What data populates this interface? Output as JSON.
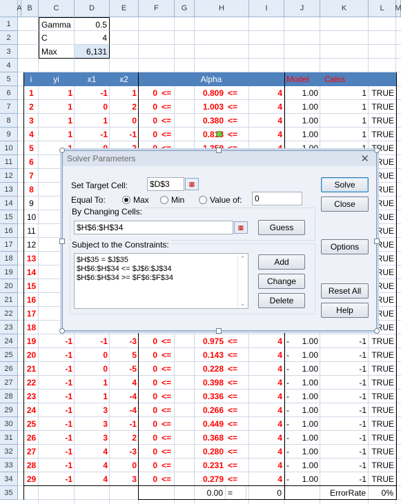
{
  "columns": [
    "A",
    "B",
    "C",
    "D",
    "E",
    "F",
    "G",
    "H",
    "I",
    "J",
    "K",
    "L",
    "M"
  ],
  "rows": [
    "1",
    "2",
    "3",
    "4",
    "5",
    "6",
    "7",
    "8",
    "9",
    "10",
    "11",
    "12",
    "13",
    "14",
    "15",
    "16",
    "17",
    "18",
    "19",
    "20",
    "21",
    "22",
    "23",
    "24",
    "25",
    "26",
    "27",
    "28",
    "29",
    "30",
    "31",
    "32",
    "33",
    "34",
    "35"
  ],
  "params": {
    "gamma_label": "Gamma",
    "gamma_value": "0.5",
    "c_label": "C",
    "c_value": "4",
    "max_label": "Max",
    "max_value": "6,131"
  },
  "table_header": {
    "i": "i",
    "yi": "yi",
    "x1": "x1",
    "x2": "x2",
    "alpha": "Alpha",
    "model": "Model",
    "class": "Calss"
  },
  "data_rows": [
    {
      "i": "1",
      "yi": "1",
      "x1": "-1",
      "x2": "1",
      "lo": "0",
      "le1": "<=",
      "alpha": "0.809",
      "le2": "<=",
      "c": "4",
      "neg": "",
      "model": "1.00",
      "cls": "1",
      "ok": "TRUE"
    },
    {
      "i": "2",
      "yi": "1",
      "x1": "0",
      "x2": "2",
      "lo": "0",
      "le1": "<=",
      "alpha": "1.003",
      "le2": "<=",
      "c": "4",
      "neg": "",
      "model": "1.00",
      "cls": "1",
      "ok": "TRUE"
    },
    {
      "i": "3",
      "yi": "1",
      "x1": "1",
      "x2": "0",
      "lo": "0",
      "le1": "<=",
      "alpha": "0.380",
      "le2": "<=",
      "c": "4",
      "neg": "",
      "model": "1.00",
      "cls": "1",
      "ok": "TRUE"
    },
    {
      "i": "4",
      "yi": "1",
      "x1": "-1",
      "x2": "-1",
      "lo": "0",
      "le1": "<=",
      "alpha": "0.818",
      "le2": "<=",
      "c": "4",
      "neg": "",
      "model": "1.00",
      "cls": "1",
      "ok": "TRUE"
    },
    {
      "i": "5",
      "yi": "1",
      "x1": "0",
      "x2": "-2",
      "lo": "0",
      "le1": "<=",
      "alpha": "1.359",
      "le2": "<=",
      "c": "4",
      "neg": "",
      "model": "1.00",
      "cls": "1",
      "ok": "TRUE"
    },
    {
      "i": "6",
      "ok": "TRUE"
    },
    {
      "i": "7",
      "ok": "TRUE"
    },
    {
      "i": "8",
      "ok": "TRUE"
    },
    {
      "i": "9",
      "ok": "TRUE"
    },
    {
      "i": "10",
      "ok": "TRUE"
    },
    {
      "i": "11",
      "ok": "TRUE"
    },
    {
      "i": "12",
      "ok": "TRUE"
    },
    {
      "i": "13",
      "ok": "TRUE"
    },
    {
      "i": "14",
      "ok": "TRUE"
    },
    {
      "i": "15",
      "ok": "TRUE"
    },
    {
      "i": "16",
      "ok": "TRUE"
    },
    {
      "i": "17",
      "ok": "TRUE"
    },
    {
      "i": "18",
      "ok": "TRUE"
    },
    {
      "i": "19",
      "yi": "-1",
      "x1": "-1",
      "x2": "-3",
      "lo": "0",
      "le1": "<=",
      "alpha": "0.975",
      "le2": "<=",
      "c": "4",
      "neg": "-",
      "model": "1.00",
      "cls": "-1",
      "ok": "TRUE"
    },
    {
      "i": "20",
      "yi": "-1",
      "x1": "0",
      "x2": "5",
      "lo": "0",
      "le1": "<=",
      "alpha": "0.143",
      "le2": "<=",
      "c": "4",
      "neg": "-",
      "model": "1.00",
      "cls": "-1",
      "ok": "TRUE"
    },
    {
      "i": "21",
      "yi": "-1",
      "x1": "0",
      "x2": "-5",
      "lo": "0",
      "le1": "<=",
      "alpha": "0.228",
      "le2": "<=",
      "c": "4",
      "neg": "-",
      "model": "1.00",
      "cls": "-1",
      "ok": "TRUE"
    },
    {
      "i": "22",
      "yi": "-1",
      "x1": "1",
      "x2": "4",
      "lo": "0",
      "le1": "<=",
      "alpha": "0.398",
      "le2": "<=",
      "c": "4",
      "neg": "-",
      "model": "1.00",
      "cls": "-1",
      "ok": "TRUE"
    },
    {
      "i": "23",
      "yi": "-1",
      "x1": "1",
      "x2": "-4",
      "lo": "0",
      "le1": "<=",
      "alpha": "0.336",
      "le2": "<=",
      "c": "4",
      "neg": "-",
      "model": "1.00",
      "cls": "-1",
      "ok": "TRUE"
    },
    {
      "i": "24",
      "yi": "-1",
      "x1": "3",
      "x2": "-4",
      "lo": "0",
      "le1": "<=",
      "alpha": "0.266",
      "le2": "<=",
      "c": "4",
      "neg": "-",
      "model": "1.00",
      "cls": "-1",
      "ok": "TRUE"
    },
    {
      "i": "25",
      "yi": "-1",
      "x1": "3",
      "x2": "-1",
      "lo": "0",
      "le1": "<=",
      "alpha": "0.449",
      "le2": "<=",
      "c": "4",
      "neg": "-",
      "model": "1.00",
      "cls": "-1",
      "ok": "TRUE"
    },
    {
      "i": "26",
      "yi": "-1",
      "x1": "3",
      "x2": "2",
      "lo": "0",
      "le1": "<=",
      "alpha": "0.368",
      "le2": "<=",
      "c": "4",
      "neg": "-",
      "model": "1.00",
      "cls": "-1",
      "ok": "TRUE"
    },
    {
      "i": "27",
      "yi": "-1",
      "x1": "4",
      "x2": "-3",
      "lo": "0",
      "le1": "<=",
      "alpha": "0.280",
      "le2": "<=",
      "c": "4",
      "neg": "-",
      "model": "1.00",
      "cls": "-1",
      "ok": "TRUE"
    },
    {
      "i": "28",
      "yi": "-1",
      "x1": "4",
      "x2": "0",
      "lo": "0",
      "le1": "<=",
      "alpha": "0.231",
      "le2": "<=",
      "c": "4",
      "neg": "-",
      "model": "1.00",
      "cls": "-1",
      "ok": "TRUE"
    },
    {
      "i": "29",
      "yi": "-1",
      "x1": "4",
      "x2": "3",
      "lo": "0",
      "le1": "<=",
      "alpha": "0.279",
      "le2": "<=",
      "c": "4",
      "neg": "-",
      "model": "1.00",
      "cls": "-1",
      "ok": "TRUE"
    }
  ],
  "footer": {
    "sum": "0.00",
    "eq": "=",
    "zero": "0",
    "error_label": "ErrorRate",
    "error_value": "0%"
  },
  "dialog": {
    "title": "Solver Parameters",
    "close_glyph": "✕",
    "target_label": "Set Target Cell:",
    "target_value": "$D$3",
    "equal_label": "Equal To:",
    "max_label": "Max",
    "min_label": "Min",
    "value_of_label": "Value of:",
    "value_of_value": "0",
    "changing_label": "By Changing Cells:",
    "changing_value": "$H$6:$H$34",
    "constraints_label": "Subject to the Constraints:",
    "constraints": [
      "$H$35 = $J$35",
      "$H$6:$H$34 <= $J$6:$J$34",
      "$H$6:$H$34 >= $F$6:$F$34"
    ],
    "buttons": {
      "solve": "Solve",
      "close": "Close",
      "guess": "Guess",
      "options": "Options",
      "add": "Add",
      "change": "Change",
      "delete": "Delete",
      "reset": "Reset All",
      "help": "Help"
    }
  },
  "colors": {
    "header_blue": "#4f81bd",
    "red": "#ff0000",
    "grid": "#d0d7e5",
    "row_header": "#e4ecf7"
  }
}
